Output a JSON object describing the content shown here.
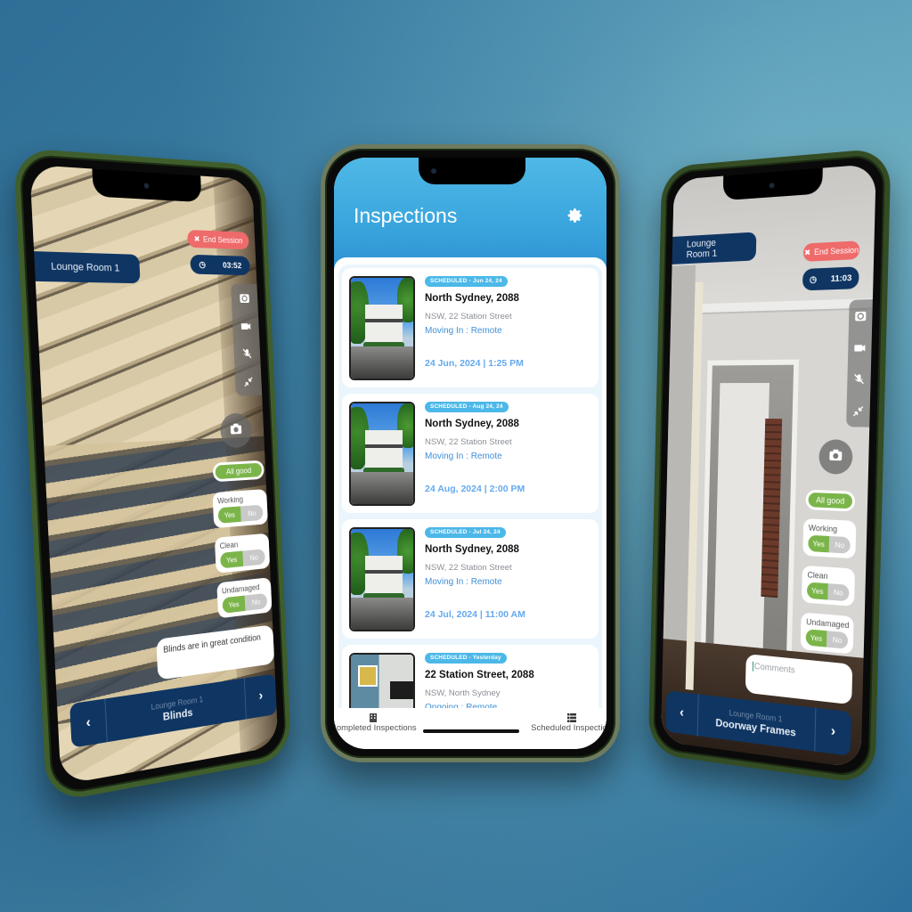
{
  "center_phone": {
    "header": {
      "title": "Inspections",
      "settings_icon": "gear-icon"
    },
    "inspections": [
      {
        "badge": "SCHEDULED - Jun 24, 24",
        "title": "North Sydney, 2088",
        "address": "NSW, 22 Station Street",
        "type": "Moving In : Remote",
        "datetime": "24 Jun, 2024 | 1:25 PM",
        "thumbnail": "house-exterior"
      },
      {
        "badge": "SCHEDULED - Aug 24, 24",
        "title": "North Sydney, 2088",
        "address": "NSW, 22 Station Street",
        "type": "Moving In : Remote",
        "datetime": "24 Aug, 2024 | 2:00 PM",
        "thumbnail": "house-exterior"
      },
      {
        "badge": "SCHEDULED - Jul 24, 24",
        "title": "North Sydney, 2088",
        "address": "NSW, 22 Station Street",
        "type": "Moving In : Remote",
        "datetime": "24 Jul, 2024 | 11:00 AM",
        "thumbnail": "house-exterior"
      },
      {
        "badge": "SCHEDULED - Yesterday",
        "title": "22 Station Street, 2088",
        "address": "NSW, North Sydney",
        "type": "Ongoing : Remote",
        "datetime": "",
        "thumbnail": "living-room-interior"
      }
    ],
    "tabbar": {
      "completed": {
        "label": "Completed Inspections",
        "icon": "building-icon"
      },
      "scheduled": {
        "label": "Scheduled Inspection",
        "icon": "list-icon"
      }
    }
  },
  "left_phone": {
    "room_label": "Lounge Room 1",
    "end_session_label": "End Session",
    "timer": "03:52",
    "side_controls": [
      "camera-switch-icon",
      "video-icon",
      "mic-off-icon",
      "minimize-icon"
    ],
    "all_good_label": "All good",
    "checks": [
      {
        "label": "Working",
        "yes": "Yes",
        "no": "No",
        "selected": "Yes"
      },
      {
        "label": "Clean",
        "yes": "Yes",
        "no": "No",
        "selected": "Yes"
      },
      {
        "label": "Undamaged",
        "yes": "Yes",
        "no": "No",
        "selected": "Yes"
      }
    ],
    "comment": "Blinds are in great condition",
    "nav": {
      "room": "Lounge Room 1",
      "item": "Blinds",
      "prev": "‹",
      "next": "›"
    }
  },
  "right_phone": {
    "room_label": "Lounge Room 1",
    "end_session_label": "End Session",
    "timer": "11:03",
    "side_controls": [
      "camera-switch-icon",
      "video-icon",
      "mic-off-icon",
      "minimize-icon"
    ],
    "all_good_label": "All good",
    "checks": [
      {
        "label": "Working",
        "yes": "Yes",
        "no": "No",
        "selected": "Yes"
      },
      {
        "label": "Clean",
        "yes": "Yes",
        "no": "No",
        "selected": "Yes"
      },
      {
        "label": "Undamaged",
        "yes": "Yes",
        "no": "No",
        "selected": "Yes"
      }
    ],
    "comment_placeholder": "Comments",
    "nav": {
      "room": "Lounge Room 1",
      "item": "Doorway Frames",
      "prev": "‹",
      "next": "›"
    }
  },
  "colors": {
    "brand_navy": "#0f3563",
    "header_blue": "#3aa6dd",
    "end_session_red": "#ef6a6a",
    "good_green": "#7bb54a",
    "badge_blue": "#4cb8e8",
    "link_blue": "#3f8fd8"
  }
}
